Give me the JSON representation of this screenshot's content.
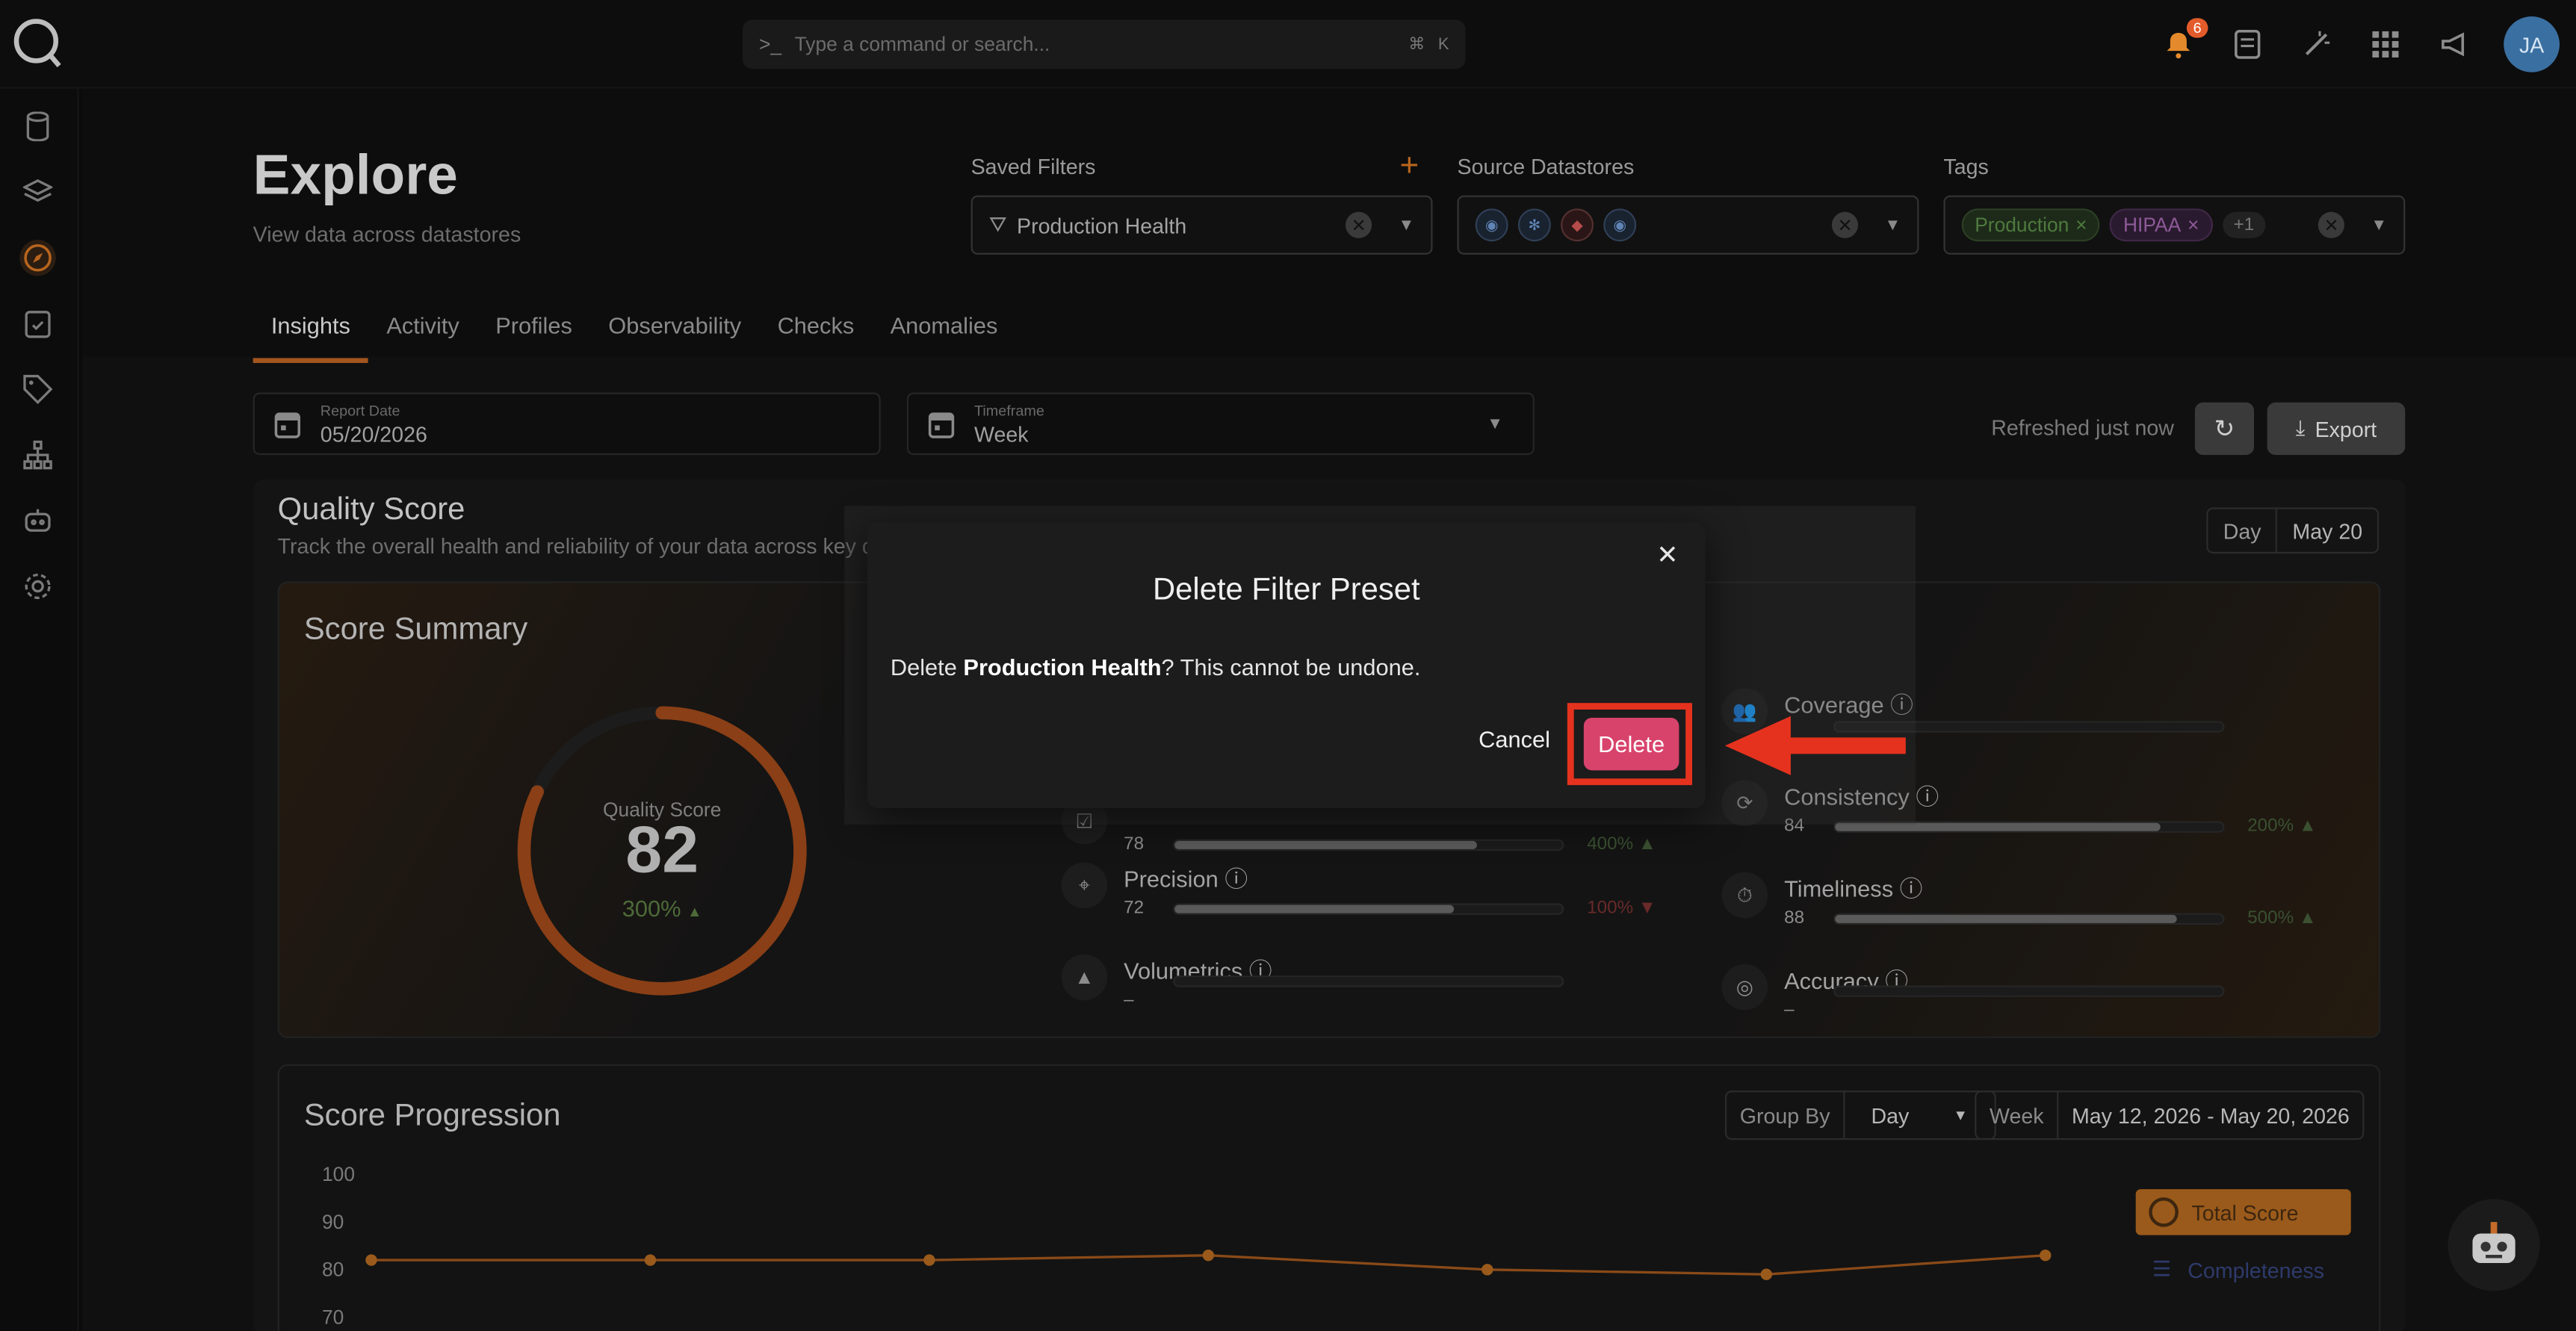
{
  "topbar": {
    "search_placeholder": "Type a command or search...",
    "shortcut_cmd": "⌘",
    "shortcut_key": "K",
    "notification_count": "6",
    "avatar_initials": "JA"
  },
  "page": {
    "title": "Explore",
    "subtitle": "View data across datastores"
  },
  "filters": {
    "saved_filters_label": "Saved Filters",
    "saved_filters_value": "Production Health",
    "source_datastores_label": "Source Datastores",
    "tags_label": "Tags",
    "tags": [
      "Production",
      "HIPAA"
    ],
    "tags_more": "+1"
  },
  "tabs": [
    "Insights",
    "Activity",
    "Profiles",
    "Observability",
    "Checks",
    "Anomalies"
  ],
  "controls": {
    "report_date_label": "Report Date",
    "report_date_value": "05/20/2026",
    "timeframe_label": "Timeframe",
    "timeframe_value": "Week",
    "refreshed": "Refreshed just now",
    "export": "Export"
  },
  "quality": {
    "title": "Quality Score",
    "subtitle": "Track the overall health and reliability of your data across key d",
    "day_label": "Day",
    "day_value": "May 20",
    "summary_title": "Score Summary",
    "gauge_label": "Quality Score",
    "gauge_value": "82",
    "gauge_change": "300%",
    "gauge_fraction": 0.82
  },
  "metrics": {
    "left": [
      {
        "name": "",
        "value": "78",
        "change": "400%",
        "fill": 0.78
      },
      {
        "name": "Precision",
        "value": "72",
        "change": "100%",
        "fill": 0.72
      },
      {
        "name": "Volumetrics",
        "value": "–",
        "change": "",
        "fill": 0
      }
    ],
    "right": [
      {
        "name": "Coverage",
        "value": "",
        "change": "",
        "fill": 0
      },
      {
        "name": "Consistency",
        "value": "84",
        "change": "200%",
        "fill": 0.84
      },
      {
        "name": "Timeliness",
        "value": "88",
        "change": "500%",
        "fill": 0.88
      },
      {
        "name": "Accuracy",
        "value": "–",
        "change": "",
        "fill": 0
      }
    ]
  },
  "progression": {
    "title": "Score Progression",
    "group_by_label": "Group By",
    "group_by_value": "Day",
    "range_label": "Week",
    "range_value": "May 12, 2026 - May 20, 2026",
    "legend_total": "Total Score",
    "legend_completeness": "Completeness"
  },
  "chart_data": {
    "type": "line",
    "yticks": [
      "100",
      "90",
      "80",
      "70"
    ],
    "ylim": [
      70,
      100
    ],
    "series": [
      {
        "name": "Total Score",
        "values": [
          82,
          82,
          82,
          83,
          80,
          79,
          83
        ]
      }
    ]
  },
  "modal": {
    "title": "Delete Filter Preset",
    "body_prefix": "Delete ",
    "body_bold": "Production Health",
    "body_suffix": "? This cannot be undone.",
    "cancel": "Cancel",
    "delete": "Delete"
  },
  "colors": {
    "accent": "#a4561e",
    "danger": "#d8436c",
    "highlight": "#e5321e"
  }
}
